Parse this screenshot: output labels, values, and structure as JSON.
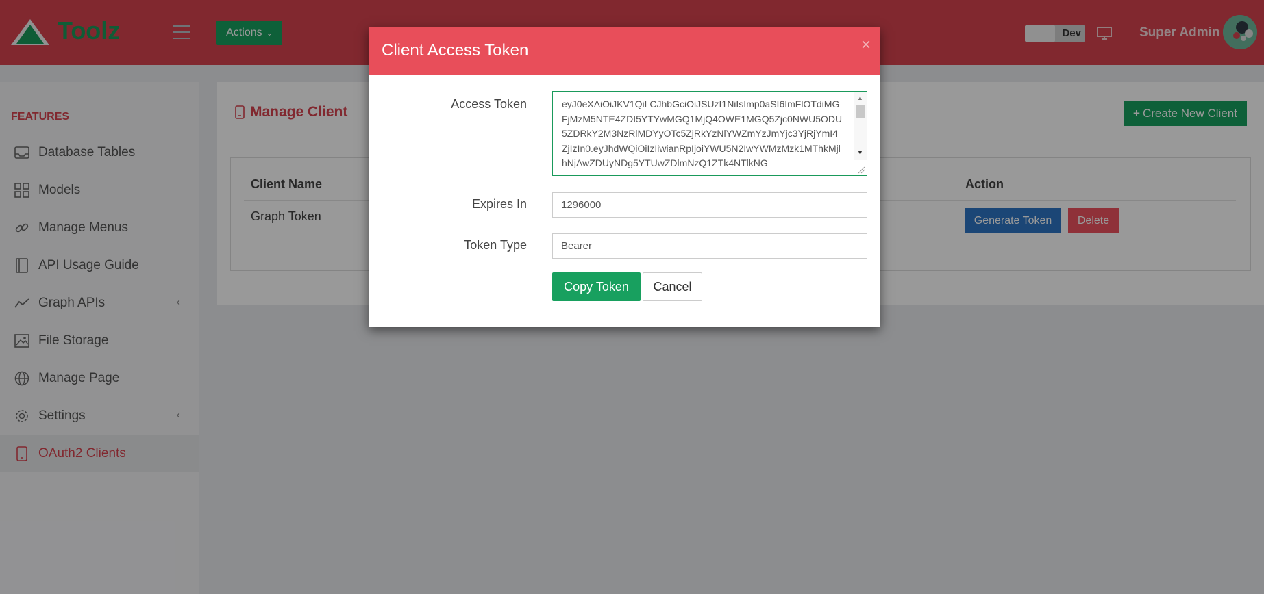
{
  "header": {
    "logo_text": "Toolz",
    "actions_label": "Actions",
    "env_label": "Dev",
    "user_name": "Super Admin"
  },
  "sidebar": {
    "section_title": "FEATURES",
    "items": [
      {
        "label": "Database Tables",
        "icon": "database-icon"
      },
      {
        "label": "Models",
        "icon": "grid-icon"
      },
      {
        "label": "Manage Menus",
        "icon": "link-icon"
      },
      {
        "label": "API Usage Guide",
        "icon": "book-icon"
      },
      {
        "label": "Graph APIs",
        "icon": "chart-line-icon",
        "has_submenu": true
      },
      {
        "label": "File Storage",
        "icon": "image-icon"
      },
      {
        "label": "Manage Page",
        "icon": "globe-icon"
      },
      {
        "label": "Settings",
        "icon": "gear-icon",
        "has_submenu": true
      },
      {
        "label": "OAuth2 Clients",
        "icon": "tablet-icon",
        "active": true
      }
    ]
  },
  "main": {
    "title": "Manage Client",
    "create_button": "Create New Client",
    "table": {
      "columns": [
        "Client Name",
        "Action"
      ],
      "rows": [
        {
          "client_name": "Graph Token",
          "actions": [
            "Generate Token",
            "Delete"
          ]
        }
      ]
    }
  },
  "modal": {
    "title": "Client Access Token",
    "close_glyph": "×",
    "access_token_label": "Access Token",
    "access_token_value": "eyJ0eXAiOiJKV1QiLCJhbGciOiJSUzI1NiIsImp0aSI6ImFlOTdiMGFjMzM5NTE4ZDI5YTYwMGQ1MjQ4OWE1MGQ5Zjc0NWU5ODU5ZDRkY2M3NzRlMDYyOTc5ZjRkYzNlYWZmYzJmYjc3YjRjYmI4ZjIzIn0.eyJhdWQiOiIzIiwianRpIjoiYWU5N2IwYWMzMzk1MThkMjlhNjAwZDUyNDg5YTUwZDlmNzQ1ZTk4NTlkNG",
    "expires_in_label": "Expires In",
    "expires_in_value": "1296000",
    "token_type_label": "Token Type",
    "token_type_value": "Bearer",
    "copy_button": "Copy Token",
    "cancel_button": "Cancel"
  },
  "colors": {
    "brand_red": "#d8434f",
    "modal_header": "#e84e5a",
    "primary_green": "#18a05f",
    "generate_blue": "#2e76c5",
    "delete_red": "#ee5360"
  }
}
